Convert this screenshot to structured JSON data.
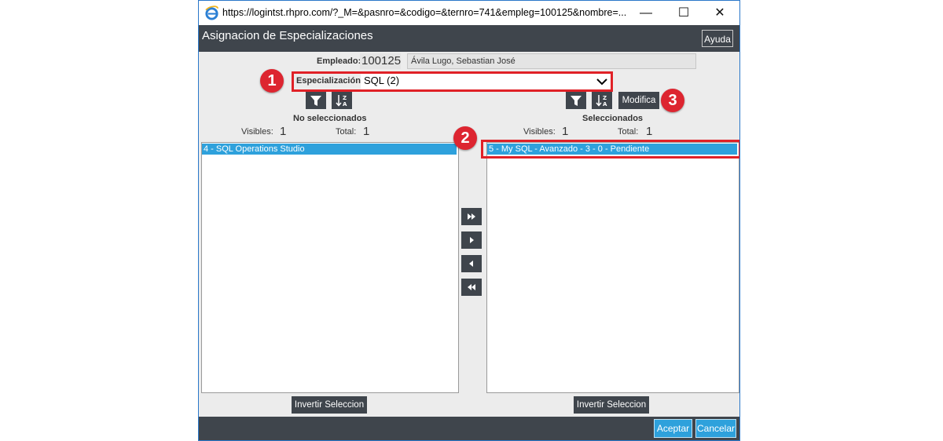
{
  "window": {
    "url": "https://logintst.rhpro.com/?_M=&pasnro=&codigo=&ternro=741&empleg=100125&nombre=...",
    "minimize": "—",
    "maximize": "☐",
    "close": "✕"
  },
  "header": {
    "title": "Asignacion de Especializaciones",
    "help_label": "Ayuda"
  },
  "form": {
    "empleado_label": "Empleado:",
    "empleado_code": "100125",
    "empleado_name": "Ávila Lugo, Sebastian José",
    "especializacion_label": "Especialización:",
    "especializacion_value": "SQL (2)"
  },
  "left_panel": {
    "title": "No seleccionados",
    "visibles_label": "Visibles:",
    "visibles_value": "1",
    "total_label": "Total:",
    "total_value": "1",
    "items": [
      "4 - SQL Operations Studio"
    ],
    "invert_label": "Invertir Seleccion"
  },
  "right_panel": {
    "title": "Seleccionados",
    "visibles_label": "Visibles:",
    "visibles_value": "1",
    "total_label": "Total:",
    "total_value": "1",
    "items": [
      "5 - My SQL - Avanzado - 3 - 0 - Pendiente"
    ],
    "modify_label": "Modifica",
    "invert_label": "Invertir Seleccion"
  },
  "callouts": [
    "1",
    "2",
    "3"
  ],
  "footer": {
    "accept_label": "Aceptar",
    "cancel_label": "Cancelar"
  },
  "colors": {
    "header_bg": "#3f454c",
    "accent": "#2ea1dc",
    "callout_red": "#e02127"
  }
}
